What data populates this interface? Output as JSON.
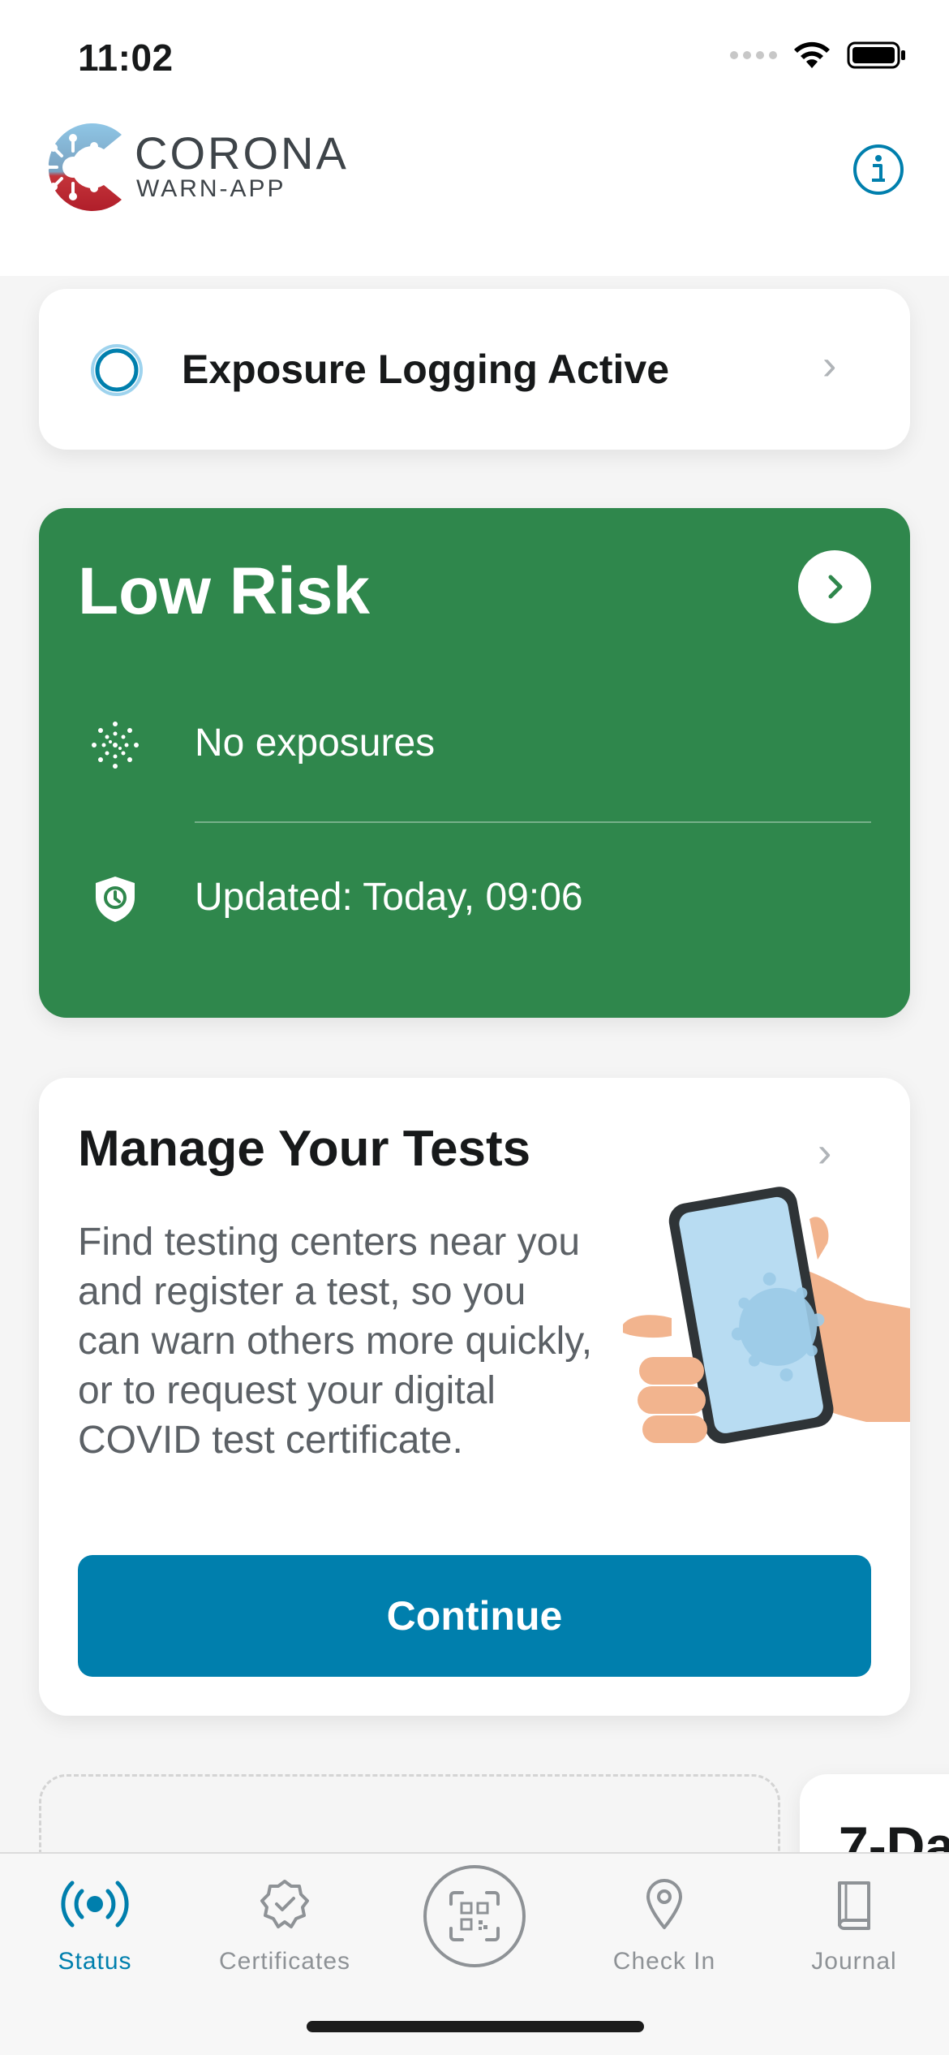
{
  "status_bar": {
    "time": "11:02",
    "icons": [
      "cellular-dots-icon",
      "wifi-icon",
      "battery-icon"
    ]
  },
  "header": {
    "logo_title": "CORONA",
    "logo_subtitle": "WARN-APP",
    "info_icon": "info-icon"
  },
  "exposure_card": {
    "label": "Exposure Logging Active",
    "icon": "exposure-active-icon"
  },
  "risk_card": {
    "title": "Low Risk",
    "exposures": "No exposures",
    "updated": "Updated: Today, 09:06",
    "background_color": "#2f874c"
  },
  "tests_card": {
    "title": "Manage Your Tests",
    "body": "Find testing centers near you and register a test, so you can warn others more quickly, or to request your digital COVID test certificate.",
    "button_label": "Continue",
    "button_color": "#007fad"
  },
  "peek_card": {
    "title": "7-Da"
  },
  "tab_bar": {
    "tabs": [
      {
        "label": "Status",
        "icon": "status-broadcast-icon",
        "active": true
      },
      {
        "label": "Certificates",
        "icon": "certificate-badge-icon",
        "active": false
      },
      {
        "label": "",
        "icon": "qr-scan-icon",
        "active": false
      },
      {
        "label": "Check In",
        "icon": "location-pin-icon",
        "active": false
      },
      {
        "label": "Journal",
        "icon": "journal-book-icon",
        "active": false
      }
    ]
  },
  "colors": {
    "accent": "#007fad",
    "risk_low": "#2f874c"
  }
}
